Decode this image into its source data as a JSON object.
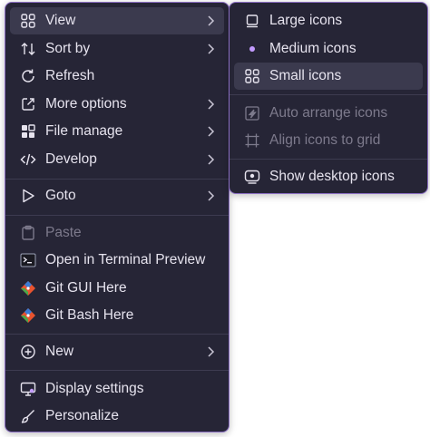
{
  "main_menu": {
    "items": [
      {
        "label": "View",
        "icon": "grid-icon"
      },
      {
        "label": "Sort by",
        "icon": "sort-icon"
      },
      {
        "label": "Refresh",
        "icon": "refresh-icon"
      },
      {
        "label": "More options",
        "icon": "external-icon"
      },
      {
        "label": "File manage",
        "icon": "apps-icon"
      },
      {
        "label": "Develop",
        "icon": "code-icon"
      },
      {
        "label": "Goto",
        "icon": "goto-icon"
      },
      {
        "label": "Paste",
        "icon": "clipboard-icon"
      },
      {
        "label": "Open in Terminal Preview",
        "icon": "terminal-icon"
      },
      {
        "label": "Git GUI Here",
        "icon": "git-icon"
      },
      {
        "label": "Git Bash Here",
        "icon": "git-icon"
      },
      {
        "label": "New",
        "icon": "plus-circle-icon"
      },
      {
        "label": "Display settings",
        "icon": "display-icon"
      },
      {
        "label": "Personalize",
        "icon": "brush-icon"
      }
    ]
  },
  "sub_menu": {
    "items": [
      {
        "label": "Large icons",
        "icon": "square-icon"
      },
      {
        "label": "Medium icons",
        "icon": "dot-icon"
      },
      {
        "label": "Small icons",
        "icon": "grid-icon"
      },
      {
        "label": "Auto arrange icons",
        "icon": "auto-arrange-icon"
      },
      {
        "label": "Align icons to grid",
        "icon": "align-grid-icon"
      },
      {
        "label": "Show desktop icons",
        "icon": "desktop-icon"
      }
    ]
  },
  "colors": {
    "menu_bg": "#262536",
    "border": "#8b6fc3",
    "hover": "#3b3a4e",
    "text": "#e6e3ee",
    "disabled_text": "#7d7a8c",
    "accent": "#c39bff"
  }
}
